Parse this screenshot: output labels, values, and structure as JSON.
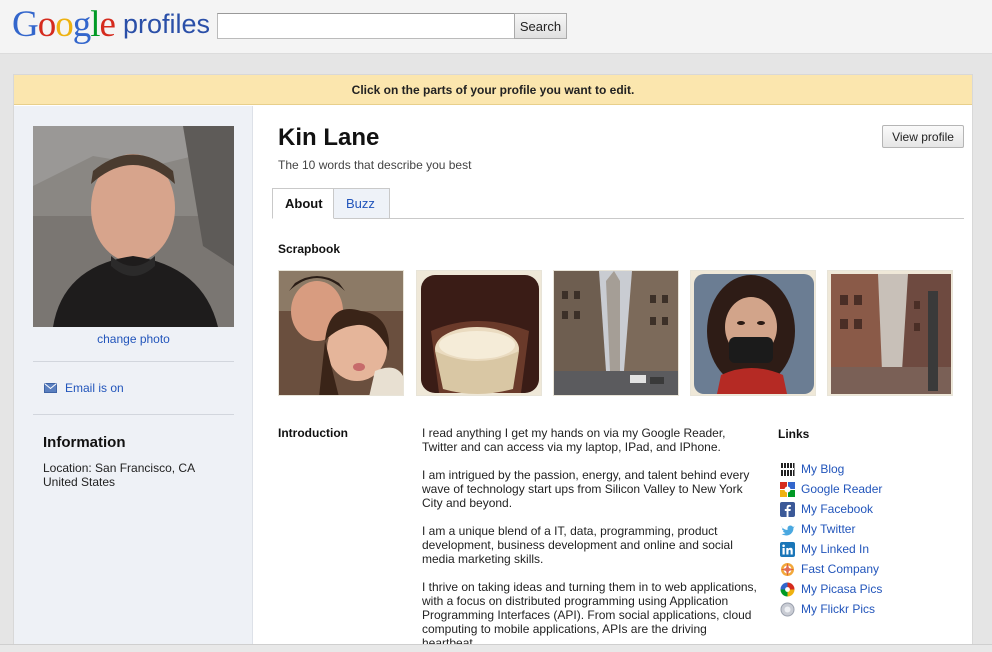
{
  "header": {
    "logo_letters": [
      "G",
      "o",
      "o",
      "g",
      "l",
      "e"
    ],
    "logo_word": "profiles",
    "search_placeholder": "",
    "search_label": "Search"
  },
  "notice": "Click on the parts of your profile you want to edit.",
  "sidebar": {
    "change_photo": "change photo",
    "email": "Email is on",
    "info_title": "Information",
    "location_line": "Location:  San Francisco, CA",
    "country_line": "United States"
  },
  "profile": {
    "name": "Kin Lane",
    "tagline": "The 10 words that describe you best",
    "view_profile_label": "View profile"
  },
  "tabs": [
    {
      "label": "About",
      "active": true
    },
    {
      "label": "Buzz",
      "active": false
    }
  ],
  "scrapbook_label": "Scrapbook",
  "introduction": {
    "label": "Introduction",
    "paragraphs": [
      "I  read anything I get my hands on via my Google Reader, Twitter and can access via my laptop, IPad, and IPhone.",
      "I am intrigued by the passion, energy, and talent behind every wave of technology start ups from Silicon Valley to New York City and beyond.",
      "I am a unique blend of a IT, data, programming, product development, business development and online and social media marketing skills.",
      "I thrive on taking ideas and turning them in to web applications, with a focus on distributed programming using Application Programming Interfaces (API).  From social applications, cloud computing to mobile applications, APIs are the driving heartbeat."
    ]
  },
  "links": {
    "label": "Links",
    "items": [
      {
        "label": "My Blog",
        "icon": "blog-icon"
      },
      {
        "label": "Google Reader",
        "icon": "google-reader-icon"
      },
      {
        "label": "My Facebook",
        "icon": "facebook-icon"
      },
      {
        "label": "My Twitter",
        "icon": "twitter-icon"
      },
      {
        "label": "My Linked In",
        "icon": "linkedin-icon"
      },
      {
        "label": "Fast Company",
        "icon": "fast-company-icon"
      },
      {
        "label": "My Picasa Pics",
        "icon": "picasa-icon"
      },
      {
        "label": "My Flickr Pics",
        "icon": "flickr-icon"
      }
    ]
  },
  "colors": {
    "accent_link": "#2255bb",
    "notice_bg": "#fbe6ae",
    "sidebar_bg": "#eef1f6"
  }
}
